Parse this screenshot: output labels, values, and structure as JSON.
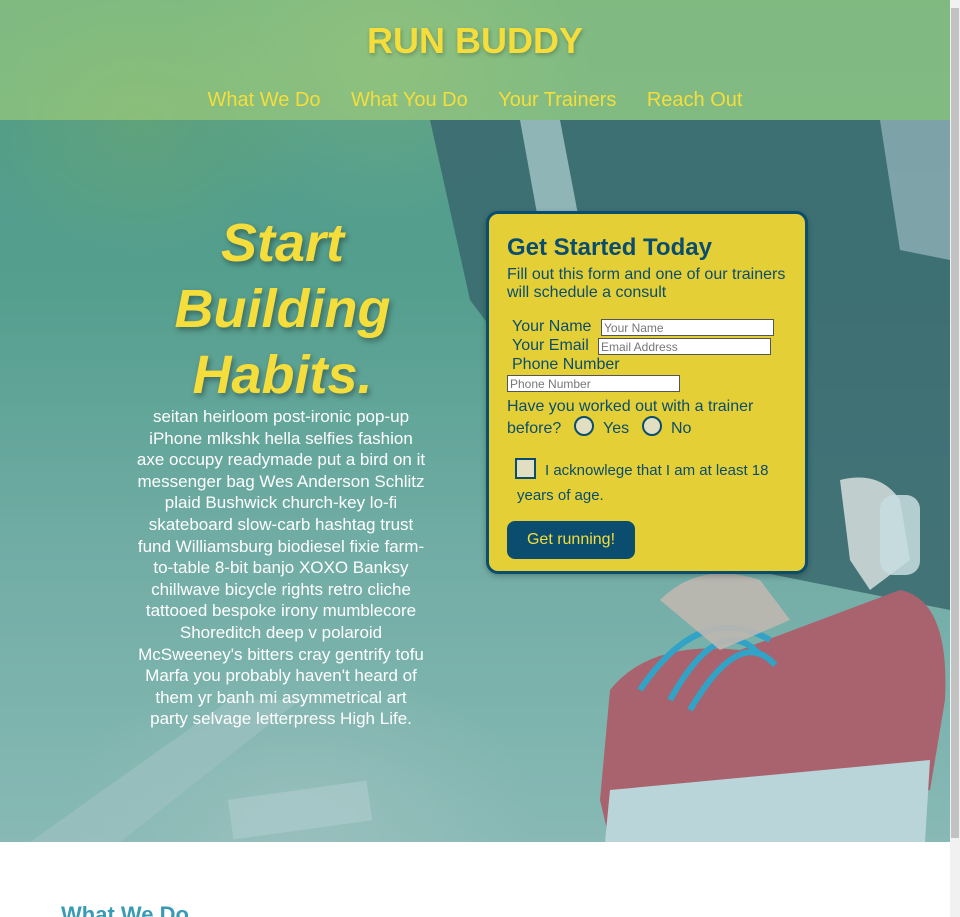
{
  "site": {
    "title": "RUN BUDDY"
  },
  "nav": {
    "items": [
      "What We Do",
      "What You Do",
      "Your Trainers",
      "Reach Out"
    ]
  },
  "hero": {
    "headline": [
      "Start",
      "Building",
      "Habits."
    ],
    "body": "seitan heirloom post-ironic pop-up iPhone mlkshk hella selfies fashion axe occupy readymade put a bird on it messenger bag Wes Anderson Schlitz plaid Bushwick church-key lo-fi skateboard slow-carb hashtag trust fund Williamsburg biodiesel fixie farm-to-table 8-bit banjo XOXO Banksy chillwave bicycle rights retro cliche tattooed bespoke irony mumblecore Shoreditch deep v polaroid McSweeney's bitters cray gentrify tofu Marfa you probably haven't heard of them yr banh mi asymmetrical art party selvage letterpress High Life."
  },
  "form": {
    "title": "Get Started Today",
    "subtitle": "Fill out this form and one of our trainers will schedule a consult",
    "name_label": "Your Name",
    "name_placeholder": "Your Name",
    "email_label": "Your Email",
    "email_placeholder": "Email Address",
    "phone_label": "Phone Number",
    "phone_placeholder": "Phone Number",
    "trainer_question_line1": "Have you worked out with a trainer",
    "trainer_question_line2": "before?",
    "yes_label": "Yes",
    "no_label": "No",
    "age_ack": "I acknowlege that I am at least 18 years of age.",
    "submit_label": "Get running!"
  },
  "sections": {
    "what_we_do_title": "What We Do"
  },
  "colors": {
    "accent_yellow": "#f5de3b",
    "navy": "#0b4d6f",
    "form_bg": "#e4cf36",
    "teal_heading": "#3a9bb5"
  }
}
